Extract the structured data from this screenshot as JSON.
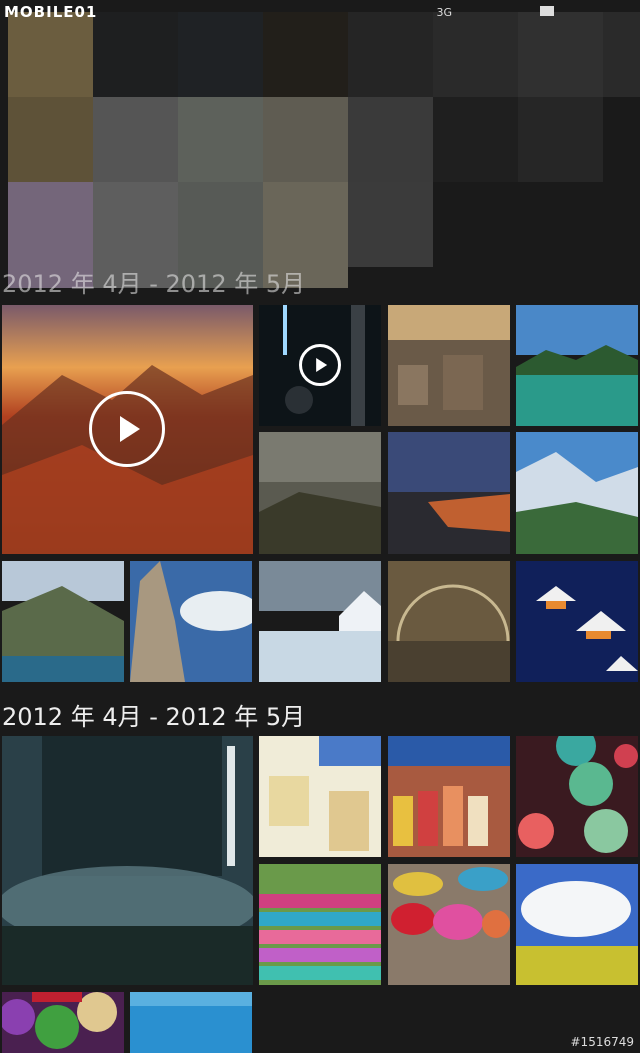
{
  "status_bar": {
    "brand": "MOBILE01",
    "network": "3G"
  },
  "sections": [
    {
      "header": "2012 年 4月 - 2012 年 5月"
    }
  ],
  "partial_header": "2012 年 4月 - 2012 年 5月",
  "watermark": "#1516749",
  "colors": {
    "background": "#1a1a1a",
    "text": "#ffffff"
  }
}
